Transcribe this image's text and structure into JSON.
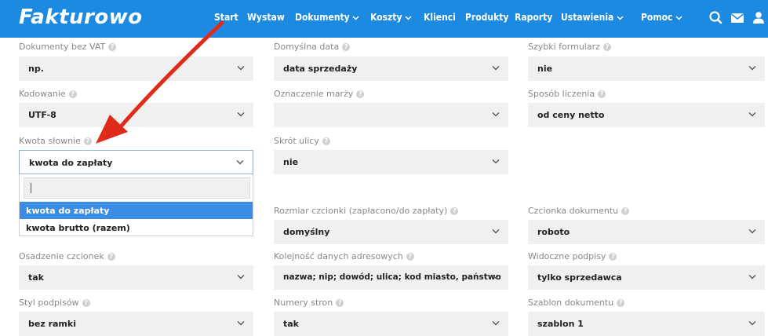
{
  "app": {
    "logo": "Fakturowo"
  },
  "nav": {
    "start": "Start",
    "wystaw": "Wystaw",
    "dokumenty": "Dokumenty",
    "koszty": "Koszty",
    "klienci": "Klienci",
    "produkty": "Produkty",
    "raporty": "Raporty",
    "ustawienia": "Ustawienia",
    "pomoc": "Pomoc",
    "icons": [
      "search-icon",
      "mail-icon",
      "user-icon"
    ]
  },
  "help_glyph": "?",
  "fields": {
    "dokumenty_bez_vat": {
      "label": "Dokumenty bez VAT",
      "value": "np."
    },
    "domyslna_data": {
      "label": "Domyślna data",
      "value": "data sprzedaży"
    },
    "szybki_formularz": {
      "label": "Szybki formularz",
      "value": "nie"
    },
    "kodowanie": {
      "label": "Kodowanie",
      "value": "UTF-8"
    },
    "oznaczenie_marzy": {
      "label": "Oznaczenie marży",
      "value": ""
    },
    "sposob_liczenia": {
      "label": "Sposób liczenia",
      "value": "od ceny netto"
    },
    "kwota_slownie": {
      "label": "Kwota słownie",
      "value": "kwota do zapłaty",
      "options": [
        "kwota do zapłaty",
        "kwota brutto (razem)"
      ]
    },
    "skrot_ulicy": {
      "label": "Skrót ulicy",
      "value": "nie"
    },
    "rozmiar_czcionki": {
      "label": "Rozmiar czcionki (zapłacono/do zapłaty)",
      "value": "domyślny"
    },
    "czcionka_dokumentu": {
      "label": "Czcionka dokumentu",
      "value": "roboto"
    },
    "osadzenie_czcionek": {
      "label": "Osadzenie czcionek",
      "value": "tak"
    },
    "kolejnosc_danych": {
      "label": "Kolejność danych adresowych",
      "value": "nazwa; nip; dowód; ulica; kod miasto, państwo"
    },
    "widoczne_podpisy": {
      "label": "Widoczne podpisy",
      "value": "tylko sprzedawca"
    },
    "styl_podpisow": {
      "label": "Styl podpisów",
      "value": "bez ramki"
    },
    "numery_stron": {
      "label": "Numery stron",
      "value": "tak"
    },
    "szablon_dokumentu": {
      "label": "Szablon dokumentu",
      "value": "szablon 1"
    }
  },
  "colors": {
    "navbar": "#1c8ae0",
    "highlight": "#3d8ce4",
    "arrow": "#e02b1a"
  }
}
